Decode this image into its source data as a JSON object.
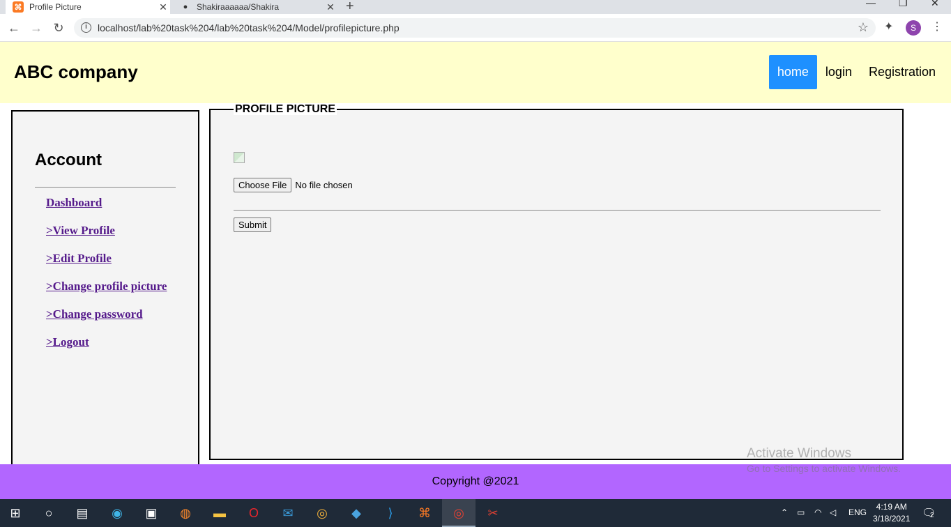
{
  "browser": {
    "tabs": [
      {
        "title": "Profile Picture",
        "icon": "xampp-icon"
      },
      {
        "title": "Shakiraaaaaa/Shakira",
        "icon": "github-icon"
      }
    ],
    "url": "localhost/lab%20task%204/lab%20task%204/Model/profilepicture.php",
    "profile_initial": "S"
  },
  "header": {
    "brand": "ABC company",
    "nav": [
      "home",
      "login",
      "Registration"
    ]
  },
  "sidebar": {
    "title": "Account",
    "items": [
      "Dashboard",
      ">View Profile",
      ">Edit Profile",
      ">Change profile picture",
      ">Change password",
      ">Logout"
    ]
  },
  "main": {
    "legend": "PROFILE PICTURE",
    "file_button": "Choose File",
    "file_status": "No file chosen",
    "submit": "Submit"
  },
  "footer": {
    "copyright": "Copyright @2021"
  },
  "watermark": {
    "line1": "Activate Windows",
    "line2": "Go to Settings to activate Windows."
  },
  "taskbar": {
    "lang": "ENG",
    "time": "4:19 AM",
    "date": "3/18/2021",
    "notifications": "2"
  },
  "colors": {
    "header_bg": "#ffffcc",
    "nav_active": "#1e90ff",
    "footer_bg": "#b266ff",
    "link": "#551a8b"
  }
}
